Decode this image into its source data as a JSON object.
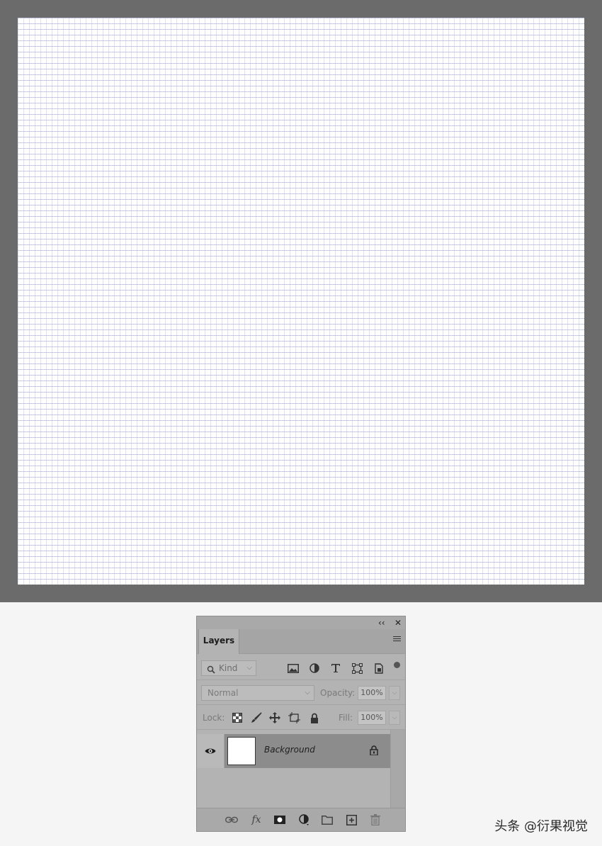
{
  "panel": {
    "collapse_glyph": "‹‹",
    "close_glyph": "✕",
    "tab_label": "Layers",
    "menu_icon": "hamburger-icon"
  },
  "filter": {
    "kind_label": "Kind",
    "icons": [
      "image-filter-icon",
      "adjustment-filter-icon",
      "type-filter-icon",
      "shape-filter-icon",
      "smart-object-filter-icon"
    ]
  },
  "blend": {
    "mode": "Normal",
    "opacity_label": "Opacity:",
    "opacity_value": "100%"
  },
  "lock": {
    "label": "Lock:",
    "fill_label": "Fill:",
    "fill_value": "100%",
    "icons": [
      "lock-transparent-icon",
      "lock-paint-icon",
      "lock-move-icon",
      "lock-artboard-icon",
      "lock-all-icon"
    ]
  },
  "layers": [
    {
      "name": "Background",
      "visible": true,
      "locked": true
    }
  ],
  "bottom_icons": [
    "link-icon",
    "fx-icon",
    "mask-icon",
    "adjustment-icon",
    "folder-icon",
    "new-layer-icon",
    "trash-icon"
  ],
  "fx_label": "fx",
  "watermark": "头条 @衍果视觉",
  "colors": {
    "canvas_frame": "#6b6b6b",
    "grid_line": "#6e78be",
    "panel_bg": "#b3b3b3",
    "selected_layer": "#8c8c8c"
  }
}
